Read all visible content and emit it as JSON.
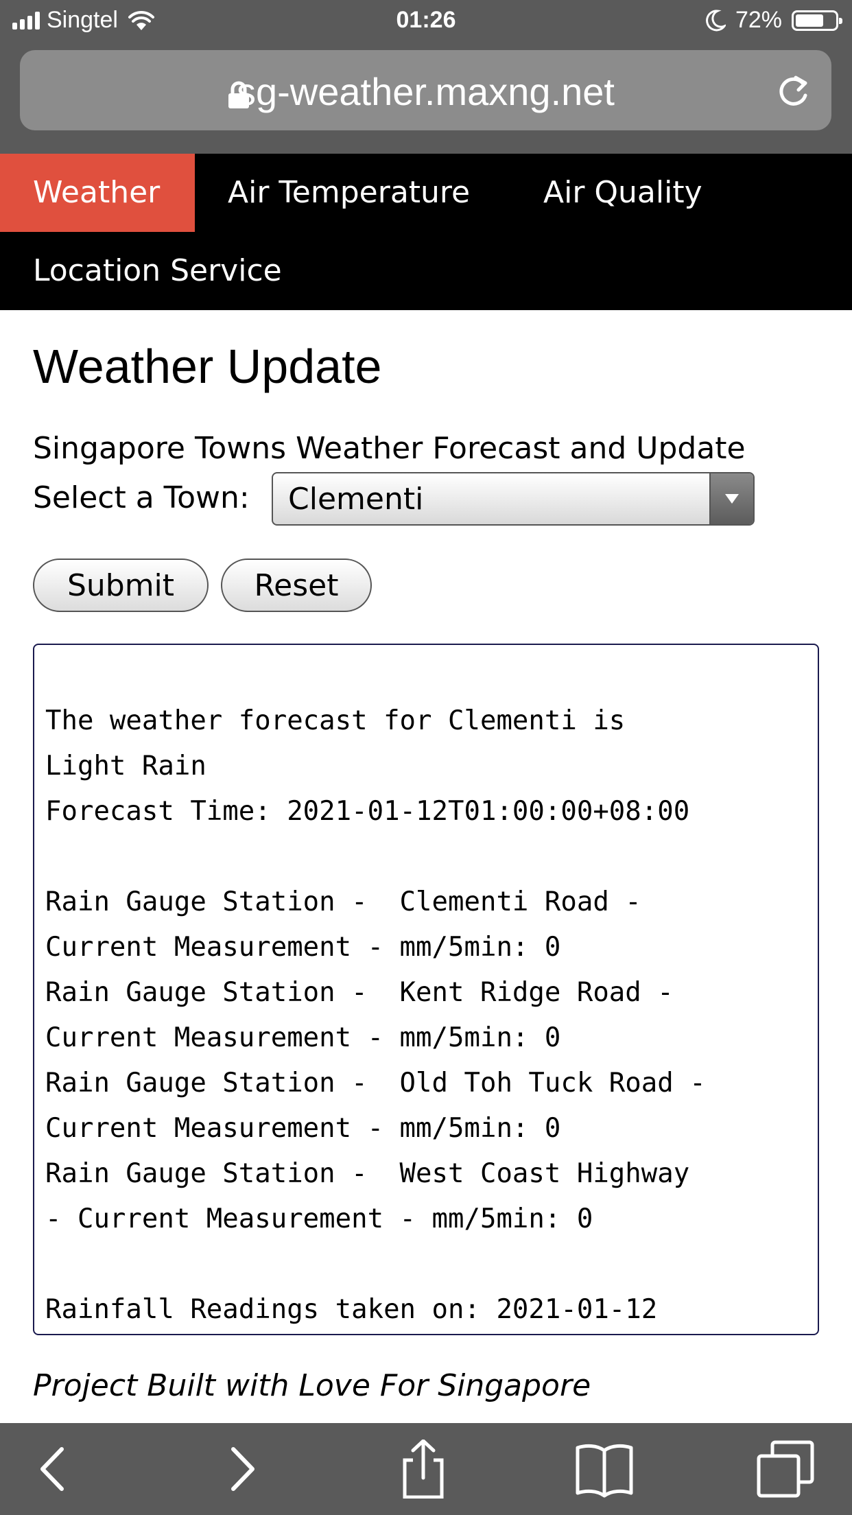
{
  "status_bar": {
    "carrier": "Singtel",
    "time": "01:26",
    "battery_percent": "72%",
    "battery_level": 0.72,
    "icons": [
      "signal-icon",
      "wifi-icon",
      "moon-icon",
      "battery-icon"
    ]
  },
  "browser": {
    "url": "sg-weather.maxng.net",
    "icons": [
      "lock-icon",
      "reload-icon"
    ]
  },
  "nav": {
    "items": [
      {
        "label": "Weather",
        "active": true
      },
      {
        "label": "Air Temperature",
        "active": false
      },
      {
        "label": "Air Quality",
        "active": false
      },
      {
        "label": "Location Service",
        "active": false
      }
    ],
    "active_color": "#e0503e"
  },
  "main": {
    "title": "Weather Update",
    "subtitle": "Singapore Towns Weather Forecast and Update",
    "select_label": "Select a Town:",
    "selected_town": "Clementi",
    "submit_label": "Submit",
    "reset_label": "Reset",
    "result_lines": [
      "",
      "The weather forecast for Clementi is",
      "Light Rain",
      "Forecast Time: 2021-01-12T01:00:00+08:00",
      "",
      "Rain Gauge Station -  Clementi Road -",
      "Current Measurement - mm/5min: 0",
      "Rain Gauge Station -  Kent Ridge Road -",
      "Current Measurement - mm/5min: 0",
      "Rain Gauge Station -  Old Toh Tuck Road -",
      "Current Measurement - mm/5min: 0",
      "Rain Gauge Station -  West Coast Highway",
      "- Current Measurement - mm/5min: 0",
      "",
      "Rainfall Readings taken on: 2021-01-12"
    ],
    "footer": "Project Built with Love For Singapore"
  },
  "toolbar": {
    "icons": [
      "back-icon",
      "forward-icon",
      "share-icon",
      "bookmarks-icon",
      "tabs-icon"
    ]
  }
}
